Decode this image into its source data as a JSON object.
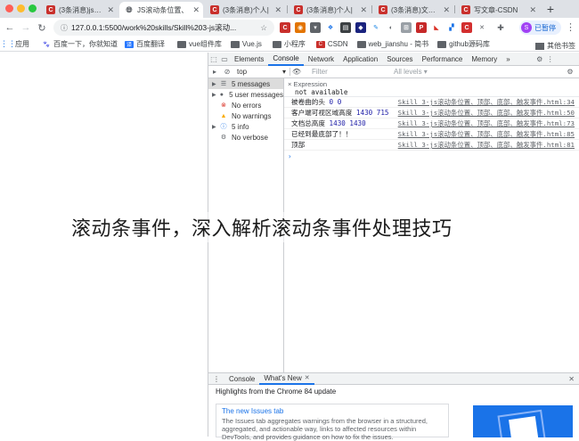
{
  "tabs": [
    {
      "label": "(3条消息)js滚动",
      "icon": "csdn-icon",
      "active": false
    },
    {
      "label": "JS滚动条位置、",
      "icon": "globe-icon",
      "active": true
    },
    {
      "label": "(3条消息)个人|",
      "icon": "csdn-icon",
      "active": false
    },
    {
      "label": "(3条消息)个人|",
      "icon": "csdn-icon",
      "active": false
    },
    {
      "label": "(3条消息)文章管",
      "icon": "csdn-icon",
      "active": false
    },
    {
      "label": "写文章-CSDN",
      "icon": "csdn-icon",
      "active": false
    }
  ],
  "toolbar": {
    "url": "127.0.0.1:5500/work%20skills/Skill%203-js滚动...",
    "profile_status": "已暂停",
    "profile_initial": "S"
  },
  "bookmarks": {
    "items": [
      "应用",
      "百度一下，你就知道",
      "百度翻译",
      "vue组件库",
      "Vue.js",
      "小程序",
      "CSDN",
      "web_jianshu - 简书",
      "github源码库"
    ],
    "other": "其他书签"
  },
  "devtools": {
    "tabs": [
      "Elements",
      "Console",
      "Network",
      "Application",
      "Sources",
      "Performance",
      "Memory",
      "»"
    ],
    "active_tab": "Console",
    "context": "top",
    "filter_placeholder": "Filter",
    "levels": "All levels ▾",
    "sidebar": [
      {
        "label": "5 messages",
        "icon": "list-icon",
        "selected": true
      },
      {
        "label": "5 user messages",
        "icon": "user-icon",
        "selected": false
      },
      {
        "label": "No errors",
        "icon": "error-icon",
        "selected": false
      },
      {
        "label": "No warnings",
        "icon": "warning-icon",
        "selected": false
      },
      {
        "label": "5 info",
        "icon": "info-icon",
        "selected": false
      },
      {
        "label": "No verbose",
        "icon": "verbose-icon",
        "selected": false
      }
    ],
    "expression_title": "Expression",
    "expression_value": "not available",
    "logs": [
      {
        "message": "被卷曲的头",
        "values": "0 0",
        "source": "Skill 3-js滚动条位置、顶部、底部、触发事件.html:34"
      },
      {
        "message": "客户端可视区域高度",
        "values": "1430 715",
        "source": "Skill 3-js滚动条位置、顶部、底部、触发事件.html:50"
      },
      {
        "message": "文档总高度",
        "values": "1430 1430",
        "source": "Skill 3-js滚动条位置、顶部、底部、触发事件.html:73"
      },
      {
        "message": "已经到最底部了！！",
        "values": "",
        "source": "Skill 3-js滚动条位置、顶部、底部、触发事件.html:85"
      },
      {
        "message": "顶部",
        "values": "",
        "source": "Skill 3-js滚动条位置、顶部、底部、触发事件.html:81"
      }
    ],
    "drawer_tabs": [
      "Console",
      "What's New"
    ],
    "highlights": "Highlights from the Chrome 84 update",
    "card_title": "The new Issues tab",
    "card_body": "The Issues tab aggregates warnings from the browser in a structured, aggregated, and actionable way, links to affected resources within DevTools, and provides guidance on how to fix the issues."
  },
  "caption": "滚动条事件，深入解析滚动条事件处理技巧"
}
